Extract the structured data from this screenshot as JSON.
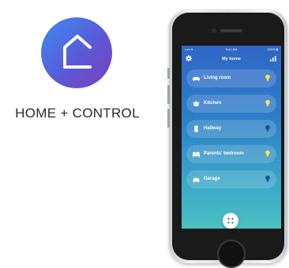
{
  "brand": {
    "app_name": "HOME + CONTROL",
    "icon": "house-outline-icon",
    "gradient": [
      "#3d8df2",
      "#5a59d8",
      "#7c3fb8"
    ]
  },
  "phone": {
    "status_bar": {
      "signal": "••••• ▾",
      "time": "9:41 AM",
      "battery": "100% ▮"
    },
    "header": {
      "title": "My home",
      "left_icon": "gear-icon",
      "right_icon": "bars-icon"
    },
    "rooms": [
      {
        "label": "Living room",
        "icon": "sofa-icon",
        "light_on": true
      },
      {
        "label": "Kitchen",
        "icon": "pot-icon",
        "light_on": true
      },
      {
        "label": "Hallway",
        "icon": "door-icon",
        "light_on": false
      },
      {
        "label": "Parents' bedroom",
        "icon": "bed-icon",
        "light_on": true
      },
      {
        "label": "Garage",
        "icon": "car-icon",
        "light_on": false
      }
    ],
    "fab_icon": "grid-dots-icon",
    "colors": {
      "bulb_on": "#ffe14d",
      "bulb_off": "#1d4f8a"
    }
  }
}
